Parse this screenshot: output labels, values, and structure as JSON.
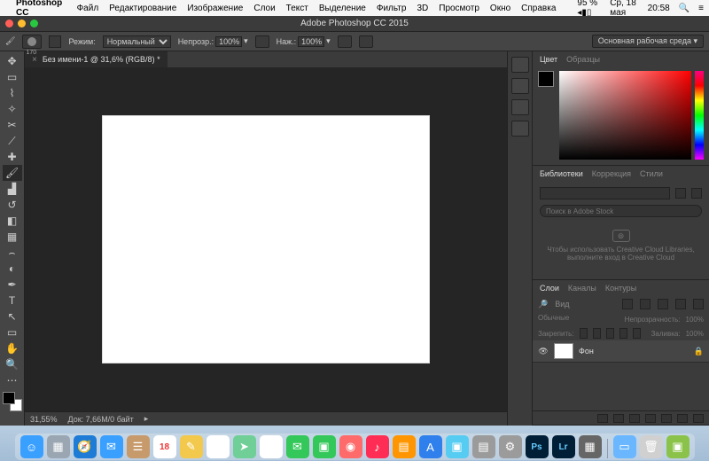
{
  "mac_menu": {
    "app": "Photoshop CC",
    "items": [
      "Файл",
      "Редактирование",
      "Изображение",
      "Слои",
      "Текст",
      "Выделение",
      "Фильтр",
      "3D",
      "Просмотр",
      "Окно",
      "Справка"
    ],
    "battery": "95 %",
    "date": "Ср, 18 мая",
    "time": "20:58"
  },
  "window_title": "Adobe Photoshop CC 2015",
  "options": {
    "brush_size": "170",
    "mode_label": "Режим:",
    "mode_value": "Нормальный",
    "opacity_label": "Непрозр.:",
    "opacity_value": "100%",
    "flow_label": "Наж.:",
    "flow_value": "100%",
    "workspace": "Основная рабочая среда"
  },
  "document": {
    "tab_label": "Без имени-1 @ 31,6% (RGB/8) *",
    "status_zoom": "31,55%",
    "status_doc": "Док:  7,66M/0 байт"
  },
  "panels": {
    "color_tabs": [
      "Цвет",
      "Образцы"
    ],
    "lib_tabs": [
      "Библиотеки",
      "Коррекция",
      "Стили"
    ],
    "lib_search_placeholder": "Поиск в Adobe Stock",
    "lib_msg1": "Чтобы использовать Creative Cloud Libraries,",
    "lib_msg2": "выполните вход в Creative Cloud",
    "layer_tabs": [
      "Слои",
      "Каналы",
      "Контуры"
    ],
    "layer_kind": "Вид",
    "layer_blend_label": "Обычные",
    "layer_opacity_label": "Непрозрачность:",
    "layer_opacity_value": "100%",
    "layer_lock_label": "Закрепить:",
    "layer_fill_label": "Заливка:",
    "layer_fill_value": "100%",
    "bg_layer_name": "Фон"
  },
  "dock": {
    "icons": [
      {
        "n": "finder",
        "c": "#3aa0ff",
        "g": "☺"
      },
      {
        "n": "launchpad",
        "c": "#9aa6b2",
        "g": "▦"
      },
      {
        "n": "safari",
        "c": "#1e7bd6",
        "g": "🧭"
      },
      {
        "n": "mail",
        "c": "#3aa0ff",
        "g": "✉"
      },
      {
        "n": "contacts",
        "c": "#c79a6b",
        "g": "☰"
      },
      {
        "n": "calendar",
        "c": "#ffffff",
        "g": "18"
      },
      {
        "n": "notes",
        "c": "#f2c94c",
        "g": "✎"
      },
      {
        "n": "reminders",
        "c": "#ffffff",
        "g": "☑"
      },
      {
        "n": "maps",
        "c": "#6fcf97",
        "g": "➤"
      },
      {
        "n": "photos",
        "c": "#ffffff",
        "g": "✿"
      },
      {
        "n": "messages",
        "c": "#34c759",
        "g": "✉"
      },
      {
        "n": "facetime",
        "c": "#34c759",
        "g": "▣"
      },
      {
        "n": "photobooth",
        "c": "#ff6b6b",
        "g": "◉"
      },
      {
        "n": "itunes",
        "c": "#ff2d55",
        "g": "♪"
      },
      {
        "n": "ibooks",
        "c": "#ff9500",
        "g": "▤"
      },
      {
        "n": "appstore",
        "c": "#2f80ed",
        "g": "A"
      },
      {
        "n": "preview",
        "c": "#56ccf2",
        "g": "▣"
      },
      {
        "n": "dictionary",
        "c": "#9b9b9b",
        "g": "▤"
      },
      {
        "n": "settings",
        "c": "#9b9b9b",
        "g": "⚙"
      },
      {
        "n": "photoshop",
        "c": "#001e36",
        "g": "Ps"
      },
      {
        "n": "lightroom",
        "c": "#001e36",
        "g": "Lr"
      },
      {
        "n": "misc1",
        "c": "#666",
        "g": "▦"
      },
      {
        "n": "folder",
        "c": "#6ab7ff",
        "g": "▭"
      },
      {
        "n": "trash",
        "c": "#d0d0d0",
        "g": "🗑"
      },
      {
        "n": "misc2",
        "c": "#8bc34a",
        "g": "▣"
      }
    ]
  }
}
